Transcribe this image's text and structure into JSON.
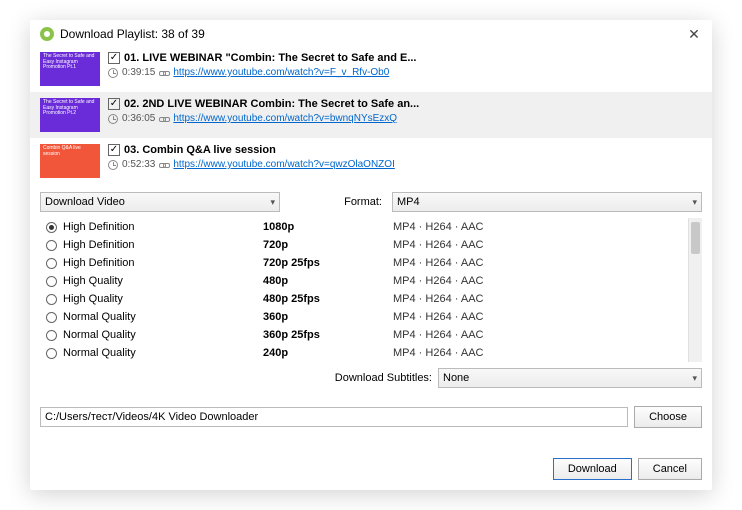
{
  "title": "Download Playlist: 38 of 39",
  "items": [
    {
      "thumb_text": "The Secret to Safe and Easy Instagram Promotion Pt.1",
      "thumb_color": "purple",
      "title": "01. LIVE WEBINAR \"Combin: The Secret to Safe and E...",
      "duration": "0:39:15",
      "url": "https://www.youtube.com/watch?v=F_v_Rfv-Ob0"
    },
    {
      "thumb_text": "The Secret to Safe and Easy Instagram Promotion Pt.2",
      "thumb_color": "purple",
      "title": "02. 2ND LIVE WEBINAR Combin: The Secret to Safe an...",
      "duration": "0:36:05",
      "url": "https://www.youtube.com/watch?v=bwnqNYsEzxQ"
    },
    {
      "thumb_text": "Combin Q&A live session",
      "thumb_color": "orange",
      "title": "03. Combin Q&A live session",
      "duration": "0:52:33",
      "url": "https://www.youtube.com/watch?v=qwzOlaONZOI"
    }
  ],
  "action_select": "Download Video",
  "format_label": "Format:",
  "format_value": "MP4",
  "qualities": [
    {
      "name": "High Definition",
      "res": "1080p",
      "codec": "MP4 · H264 · AAC",
      "selected": true
    },
    {
      "name": "High Definition",
      "res": "720p",
      "codec": "MP4 · H264 · AAC",
      "selected": false
    },
    {
      "name": "High Definition",
      "res": "720p 25fps",
      "codec": "MP4 · H264 · AAC",
      "selected": false
    },
    {
      "name": "High Quality",
      "res": "480p",
      "codec": "MP4 · H264 · AAC",
      "selected": false
    },
    {
      "name": "High Quality",
      "res": "480p 25fps",
      "codec": "MP4 · H264 · AAC",
      "selected": false
    },
    {
      "name": "Normal Quality",
      "res": "360p",
      "codec": "MP4 · H264 · AAC",
      "selected": false
    },
    {
      "name": "Normal Quality",
      "res": "360p 25fps",
      "codec": "MP4 · H264 · AAC",
      "selected": false
    },
    {
      "name": "Normal Quality",
      "res": "240p",
      "codec": "MP4 · H264 · AAC",
      "selected": false
    }
  ],
  "subtitles_label": "Download Subtitles:",
  "subtitles_value": "None",
  "path": "C:/Users/тест/Videos/4K Video Downloader",
  "choose_label": "Choose",
  "download_label": "Download",
  "cancel_label": "Cancel"
}
